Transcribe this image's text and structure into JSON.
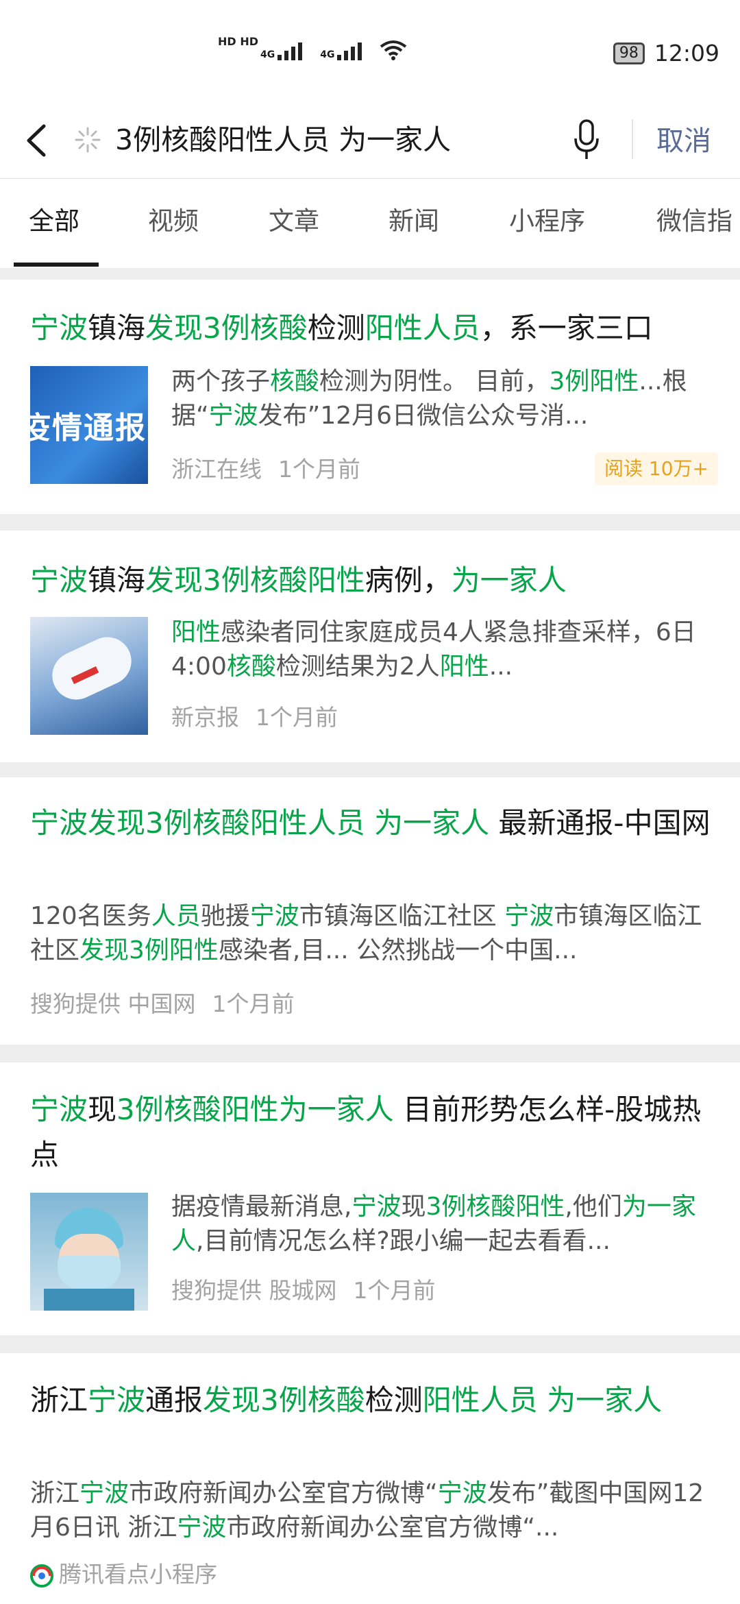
{
  "status_bar": {
    "hd1": "HD",
    "hd2": "HD",
    "net1": "4G",
    "net2": "4G",
    "battery": "98",
    "time": "12:09"
  },
  "search": {
    "query": "3例核酸阳性人员 为一家人",
    "cancel": "取消"
  },
  "tabs": [
    "全部",
    "视频",
    "文章",
    "新闻",
    "小程序",
    "微信指"
  ],
  "results": [
    {
      "title": [
        [
          "宁波",
          "h"
        ],
        [
          "镇海",
          ""
        ],
        [
          "发现3例核酸",
          "h"
        ],
        [
          "检测",
          ""
        ],
        [
          "阳性人员",
          "h"
        ],
        [
          "，系一家三口",
          ""
        ]
      ],
      "snippet": [
        [
          "两个孩子",
          ""
        ],
        [
          "核酸",
          "h"
        ],
        [
          "检测为阴性。 目前，",
          ""
        ],
        [
          "3例阳性",
          "h"
        ],
        [
          "...根据“",
          ""
        ],
        [
          "宁波",
          "h"
        ],
        [
          "发布”12月6日微信公众号消...",
          ""
        ]
      ],
      "thumb_text": "疫情通报",
      "source": "浙江在线",
      "time": "1个月前",
      "badge": "阅读 10万+"
    },
    {
      "title": [
        [
          "宁波",
          "h"
        ],
        [
          "镇海",
          ""
        ],
        [
          "发现3例核酸阳性",
          "h"
        ],
        [
          "病例，",
          ""
        ],
        [
          "为一家人",
          "h"
        ]
      ],
      "snippet": [
        [
          "阳性",
          "h"
        ],
        [
          "感染者同住家庭成员4人紧急排查采样，6日4:00",
          ""
        ],
        [
          "核酸",
          "h"
        ],
        [
          "检测结果为2人",
          ""
        ],
        [
          "阳性",
          "h"
        ],
        [
          "...",
          ""
        ]
      ],
      "source": "新京报",
      "time": "1个月前"
    },
    {
      "title": [
        [
          "宁波发现3例核酸阳性人员 为一家人",
          "h"
        ],
        [
          " 最新通报-中国网",
          ""
        ]
      ],
      "snippet": [
        [
          "120名医务",
          ""
        ],
        [
          "人员",
          "h"
        ],
        [
          "驰援",
          ""
        ],
        [
          "宁波",
          "h"
        ],
        [
          "市镇海区临江社区 ",
          ""
        ],
        [
          "宁波",
          "h"
        ],
        [
          "市镇海区临江社区",
          ""
        ],
        [
          "发现3例阳性",
          "h"
        ],
        [
          "感染者,目... 公然挑战一个中国...",
          ""
        ]
      ],
      "source": "搜狗提供 中国网",
      "time": "1个月前"
    },
    {
      "title": [
        [
          "宁波",
          "h"
        ],
        [
          "现",
          ""
        ],
        [
          "3例核酸阳性为一家人",
          "h"
        ],
        [
          " 目前形势怎么样-股城热点",
          ""
        ]
      ],
      "snippet": [
        [
          "据疫情最新消息,",
          ""
        ],
        [
          "宁波",
          "h"
        ],
        [
          "现",
          ""
        ],
        [
          "3例核酸阳性",
          "h"
        ],
        [
          ",他们",
          ""
        ],
        [
          "为一家人",
          "h"
        ],
        [
          ",目前情况怎么样?跟小编一起去看看...",
          ""
        ]
      ],
      "source": "搜狗提供 股城网",
      "time": "1个月前"
    },
    {
      "title": [
        [
          "浙江",
          ""
        ],
        [
          "宁波",
          "h"
        ],
        [
          "通报",
          ""
        ],
        [
          "发现3例核酸",
          "h"
        ],
        [
          "检测",
          ""
        ],
        [
          "阳性人员 为一家人",
          "h"
        ]
      ],
      "snippet": [
        [
          "浙江",
          ""
        ],
        [
          "宁波",
          "h"
        ],
        [
          "市政府新闻办公室官方微博“",
          ""
        ],
        [
          "宁波",
          "h"
        ],
        [
          "发布”截图中国网12月6日讯 浙江",
          ""
        ],
        [
          "宁波",
          "h"
        ],
        [
          "市政府新闻办公室官方微博“...",
          ""
        ]
      ],
      "source": "腾讯看点小程序",
      "time": ""
    }
  ],
  "colors": {
    "highlight": "#07a54a",
    "cancel": "#576b95",
    "badge": "#e6a21a",
    "background": "#ededed"
  },
  "icons": [
    "back-arrow-icon",
    "loading-spinner-icon",
    "microphone-icon",
    "battery-icon",
    "signal-icon",
    "wifi-icon",
    "tencent-kandian-icon"
  ]
}
